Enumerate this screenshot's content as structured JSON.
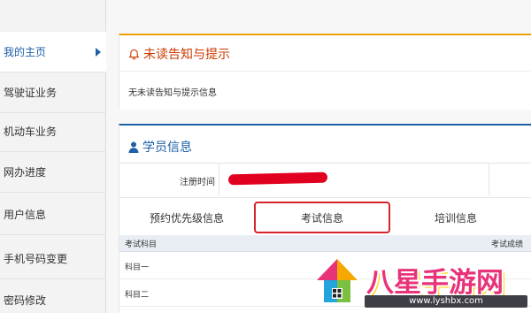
{
  "sidebar": {
    "items": [
      {
        "label": "我的主页",
        "active": true
      },
      {
        "label": "驾驶证业务",
        "active": false
      },
      {
        "label": "机动车业务",
        "active": false
      },
      {
        "label": "网办进度",
        "active": false
      },
      {
        "label": "用户信息",
        "active": false
      },
      {
        "label": "手机号码变更",
        "active": false
      },
      {
        "label": "密码修改",
        "active": false
      }
    ]
  },
  "notice": {
    "title": "未读告知与提示",
    "icon": "bell-icon",
    "text": "无未读告知与提示信息"
  },
  "student": {
    "title": "学员信息",
    "icon": "user-icon",
    "reg_label": "注册时间",
    "tabs": [
      {
        "label": "预约优先级信息",
        "active": false
      },
      {
        "label": "考试信息",
        "active": true
      },
      {
        "label": "培训信息",
        "active": false
      }
    ],
    "table": {
      "col_subject": "考试科目",
      "col_score": "考试成绩",
      "rows": [
        "科目一",
        "科目二"
      ]
    }
  },
  "watermark": {
    "brand": "八星手游网",
    "url": "www.lyshbx.com"
  },
  "colors": {
    "notice_accent": "#f0a000",
    "notice_title": "#cc3a00",
    "student_accent": "#1e5fa8",
    "active_tab_border": "#d8232a",
    "redaction": "#e1001f"
  }
}
